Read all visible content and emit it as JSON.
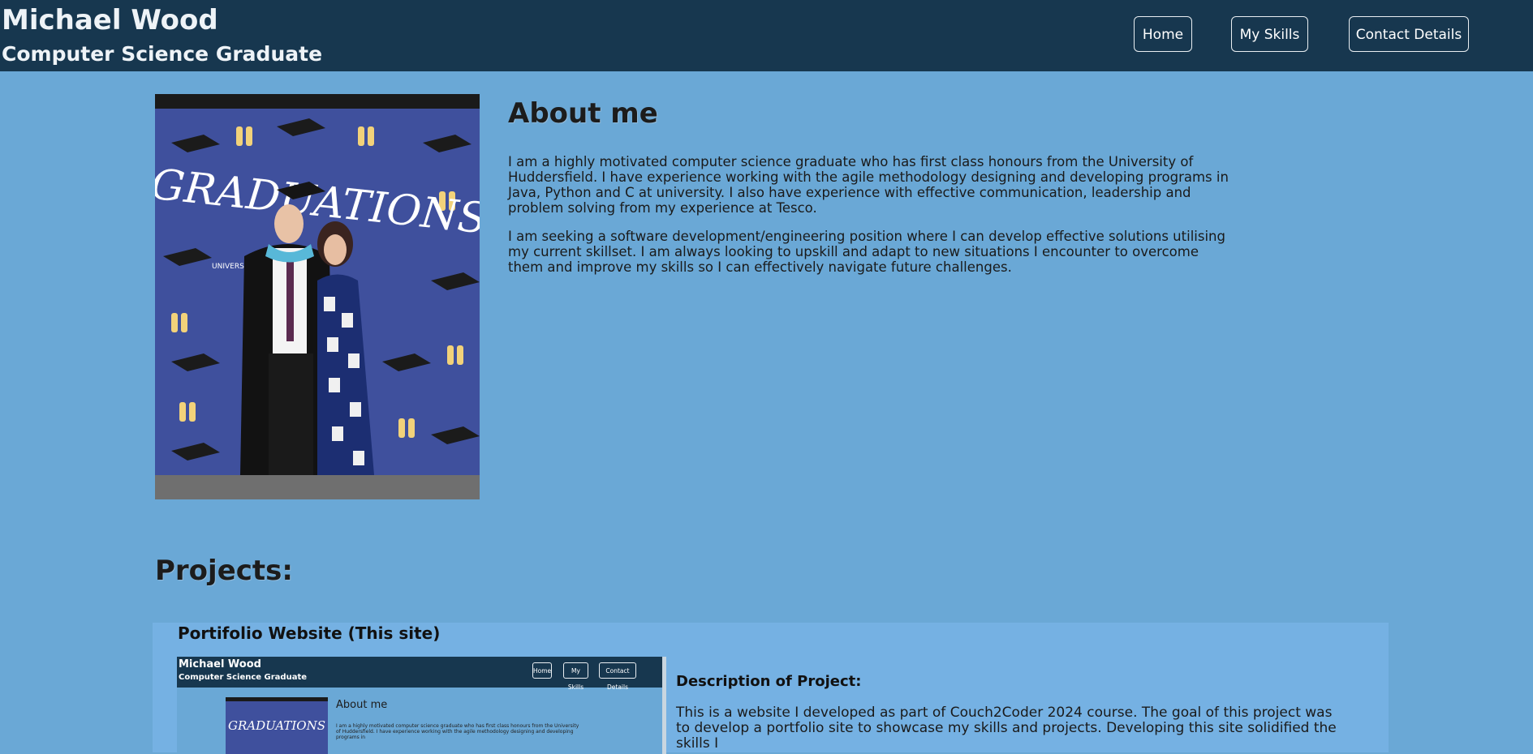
{
  "header": {
    "name": "Michael Wood",
    "subtitle": "Computer Science Graduate",
    "nav": {
      "home": "Home",
      "skills": "My Skills",
      "contact": "Contact Details"
    }
  },
  "colors": {
    "header_bg": "#17374f",
    "page_bg": "#6aa8d6",
    "card_bg": "#75b1e3",
    "photo_bg": "#3e4f9a"
  },
  "photo": {
    "banner_text": "GRADUATIONS",
    "banner_sub": "UNIVERS"
  },
  "about": {
    "heading": "About me",
    "paragraph1": "I am a highly motivated computer science graduate who has first class honours from the University of Huddersfield. I have experience working with the agile methodology designing and developing programs in Java, Python and C at university. I also have experience with effective communication, leadership and problem solving from my experience at Tesco.",
    "paragraph2": "I am seeking a software development/engineering position where I can develop effective solutions utilising my current skillset. I am always looking to upskill and adapt to new situations I encounter to overcome them and improve my skills so I can effectively navigate future challenges."
  },
  "projects": {
    "heading": "Projects:",
    "items": [
      {
        "title": "Portifolio Website (This site)",
        "screenshot": {
          "name": "Michael Wood",
          "subtitle": "Computer Science Graduate",
          "nav_home": "Home",
          "nav_skills": "My Skills",
          "nav_contact": "Contact Details",
          "about_heading": "About me",
          "about_text": "I am a highly motivated computer science graduate who has first class honours from the University of Huddersfield. I have experience working with the agile methodology designing and developing programs in"
        },
        "description_heading": "Description of Project:",
        "description": "This is a website I developed as part of Couch2Coder 2024 course. The goal of this project was to develop a portfolio site to showcase my skills and projects. Developing this site solidified the skills I"
      }
    ]
  }
}
